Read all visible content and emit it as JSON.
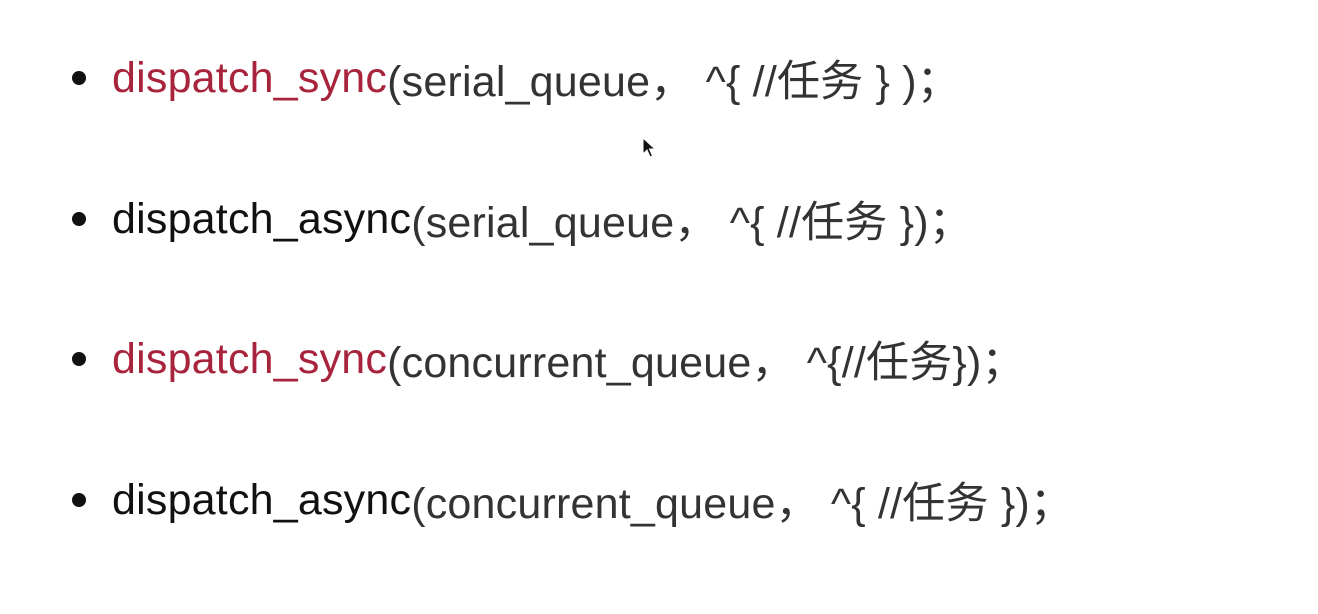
{
  "bullets": [
    {
      "function": "dispatch_sync",
      "args": "(serial_queue， ^{ //任务 } )；",
      "highlight": true
    },
    {
      "function": "dispatch_async",
      "args": "(serial_queue， ^{ //任务 })；",
      "highlight": false
    },
    {
      "function": "dispatch_sync",
      "args": "(concurrent_queue， ^{//任务})；",
      "highlight": true
    },
    {
      "function": "dispatch_async",
      "args": "(concurrent_queue， ^{ //任务 })；",
      "highlight": false
    }
  ],
  "colors": {
    "sync_function": "#a8243c",
    "async_function": "#111111",
    "arguments": "#333333",
    "background": "#ffffff"
  },
  "icons": {
    "cursor": "mouse-pointer-icon",
    "bullet": "bullet-dot-icon"
  }
}
